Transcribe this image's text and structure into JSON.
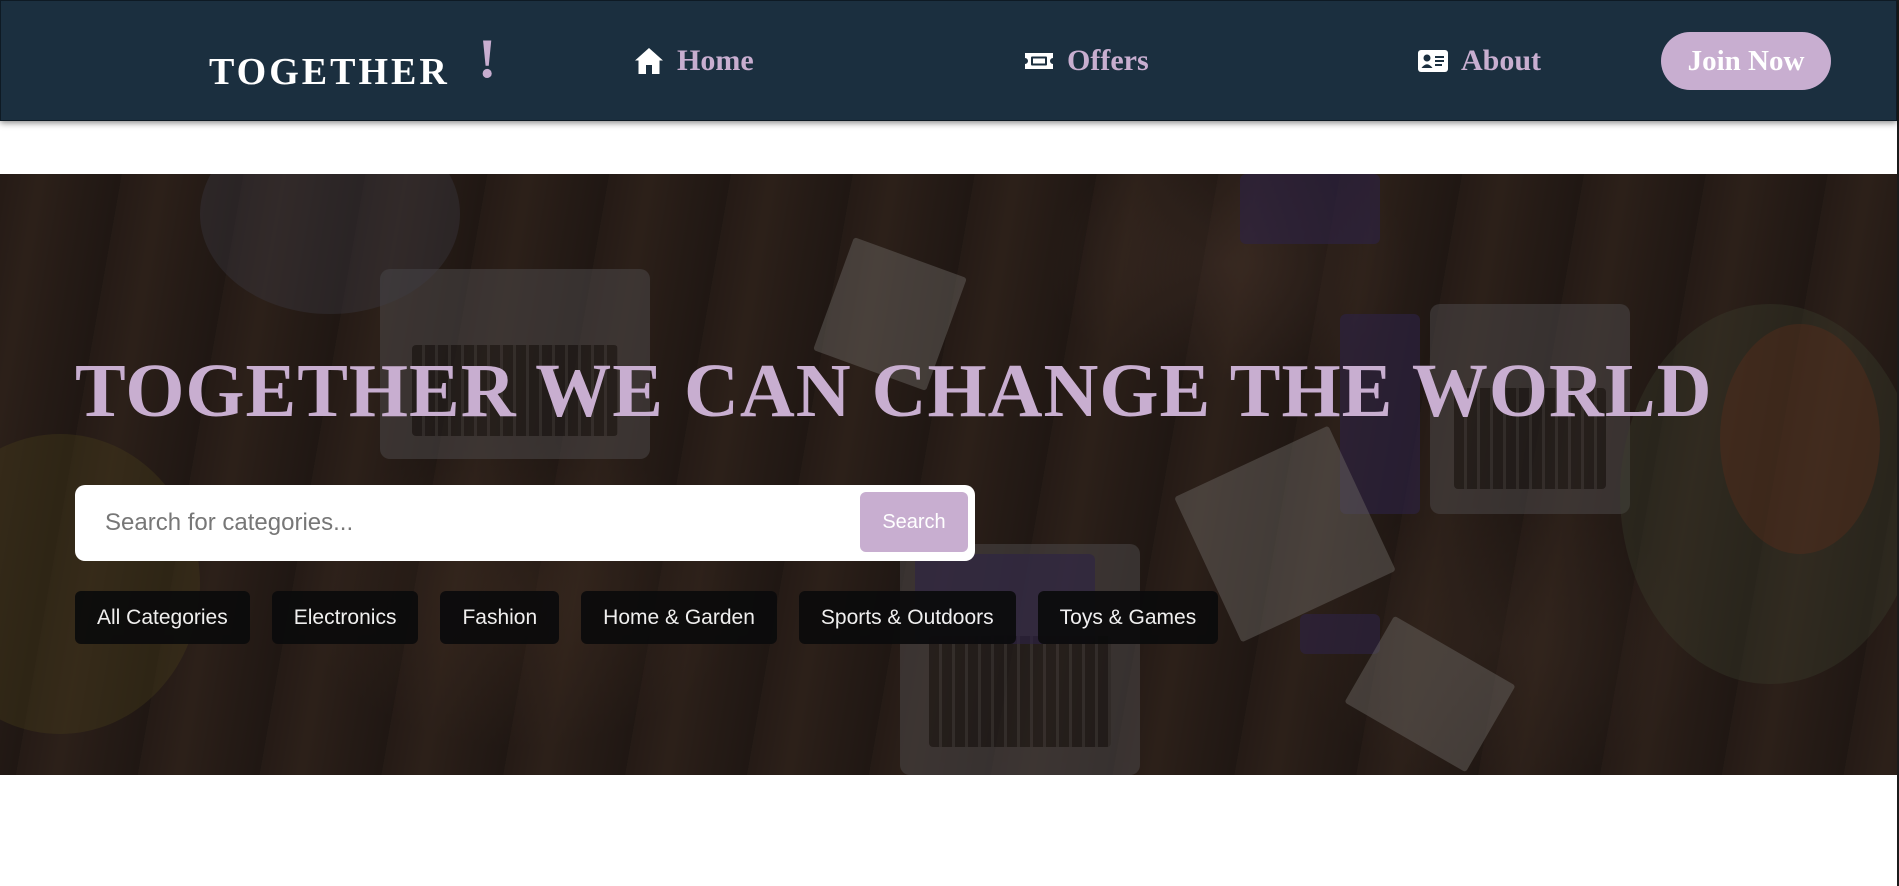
{
  "navbar": {
    "brand_name": "TOGETHER",
    "brand_mark": "!",
    "links": [
      {
        "label": "Home",
        "icon": "home-icon"
      },
      {
        "label": "Offers",
        "icon": "ticket-icon"
      },
      {
        "label": "About",
        "icon": "id-card-icon"
      }
    ],
    "join_label": "Join Now",
    "colors": {
      "background": "#1b2f3f",
      "accent": "#c8aed0",
      "brand_text": "#ffffff"
    }
  },
  "hero": {
    "title": "TOGETHER WE CAN CHANGE THE WORLD",
    "search": {
      "placeholder": "Search for categories...",
      "value": "",
      "button_label": "Search"
    },
    "categories": [
      "All Categories",
      "Electronics",
      "Fashion",
      "Home & Garden",
      "Sports & Outdoors",
      "Toys & Games"
    ]
  }
}
